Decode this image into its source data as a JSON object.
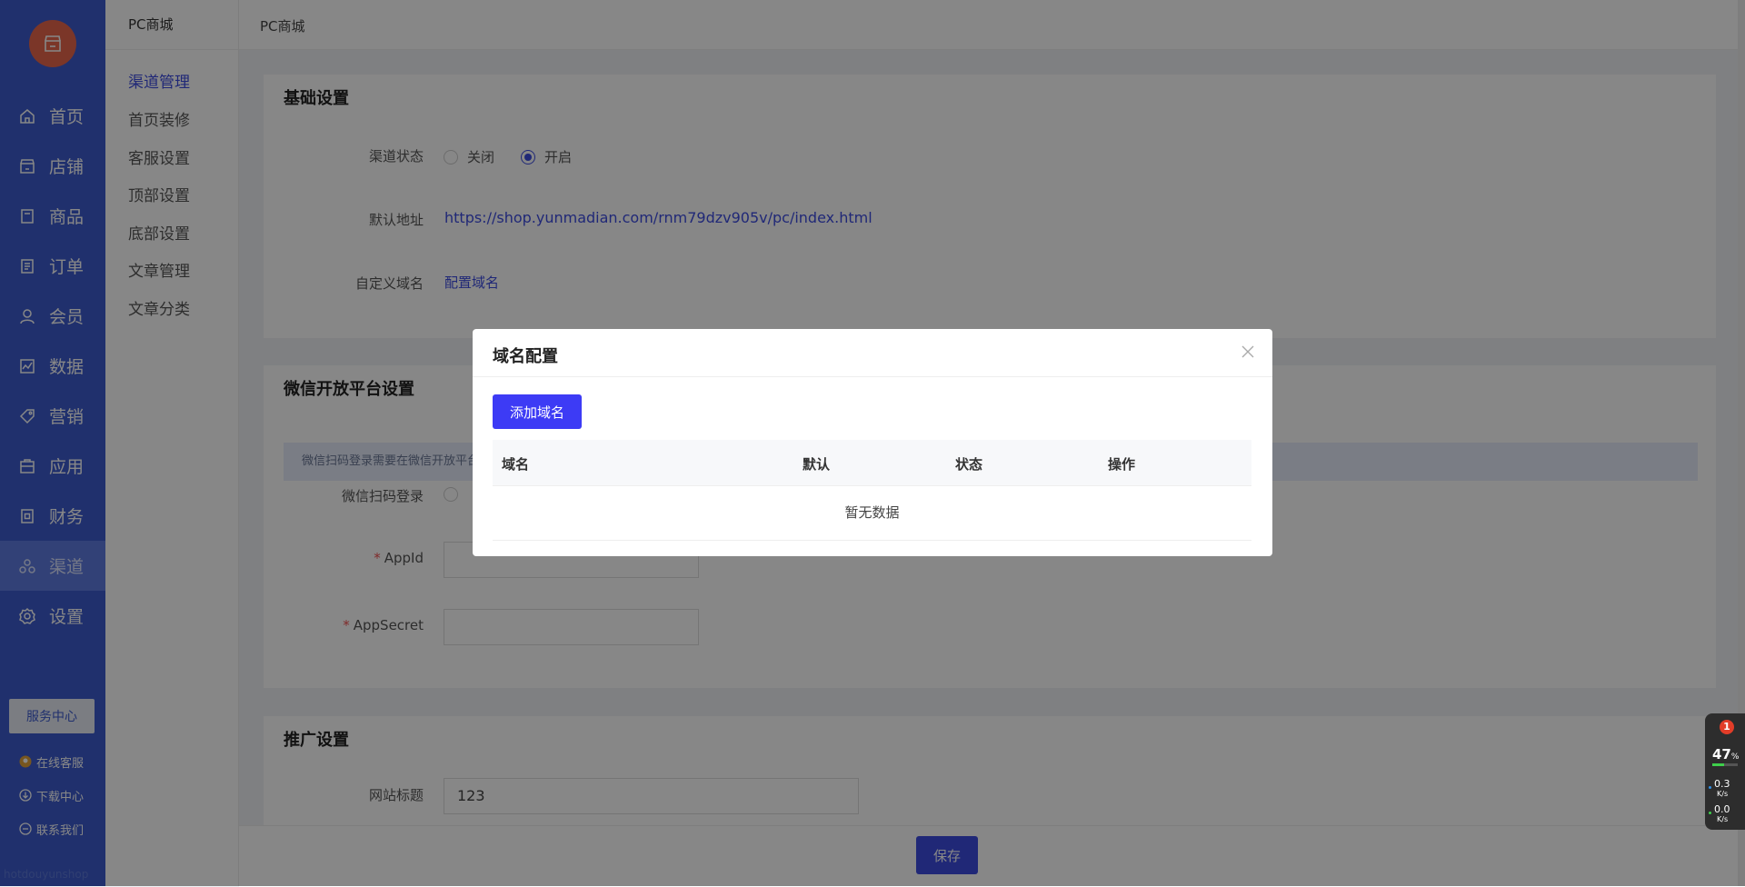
{
  "sidebar": {
    "items": [
      {
        "label": "首页",
        "icon": "home-icon"
      },
      {
        "label": "店铺",
        "icon": "shop-icon"
      },
      {
        "label": "商品",
        "icon": "product-icon"
      },
      {
        "label": "订单",
        "icon": "order-icon"
      },
      {
        "label": "会员",
        "icon": "member-icon"
      },
      {
        "label": "数据",
        "icon": "chart-icon"
      },
      {
        "label": "营销",
        "icon": "tag-icon"
      },
      {
        "label": "应用",
        "icon": "app-icon"
      },
      {
        "label": "财务",
        "icon": "finance-icon"
      },
      {
        "label": "渠道",
        "icon": "channel-icon"
      },
      {
        "label": "设置",
        "icon": "gear-icon"
      }
    ],
    "active": "渠道",
    "service_center": "服务中心",
    "online_service": "在线客服",
    "download_center": "下载中心",
    "contact_us": "联系我们",
    "watermark": "hotdouyunshop"
  },
  "subnav": {
    "title": "PC商城",
    "items": [
      "渠道管理",
      "首页装修",
      "客服设置",
      "顶部设置",
      "底部设置",
      "文章管理",
      "文章分类"
    ],
    "active": "渠道管理"
  },
  "breadcrumb": "PC商城",
  "basic": {
    "title": "基础设置",
    "status_label": "渠道状态",
    "status_off": "关闭",
    "status_on": "开启",
    "status_value": "开启",
    "default_addr_label": "默认地址",
    "default_addr": "https://shop.yunmadian.com/rnm79dzv905v/pc/index.html",
    "custom_domain_label": "自定义域名",
    "custom_domain_link": "配置域名"
  },
  "wechat": {
    "title": "微信开放平台设置",
    "tip": "微信扫码登录需要在微信开放平台",
    "scan_label": "微信扫码登录",
    "appid_label": "AppId",
    "appid_value": "",
    "appsecret_label": "AppSecret",
    "appsecret_value": ""
  },
  "promo": {
    "title": "推广设置",
    "site_title_label": "网站标题",
    "site_title_value": "123"
  },
  "save_label": "保存",
  "modal": {
    "title": "域名配置",
    "add_button": "添加域名",
    "columns": [
      "域名",
      "默认",
      "状态",
      "操作"
    ],
    "empty_text": "暂无数据"
  },
  "monitor": {
    "notification_count": "1",
    "cpu_percent": "47",
    "cpu_unit": "%",
    "cpu_fraction": 0.47,
    "upload_speed": "0.3",
    "upload_unit": "K/s",
    "download_speed": "0.0",
    "download_unit": "K/s"
  },
  "colors": {
    "sidebar": "#3d5ccf",
    "primary": "#3d4ce0",
    "add_button": "#3d3bf5",
    "logo": "#e8674d"
  }
}
